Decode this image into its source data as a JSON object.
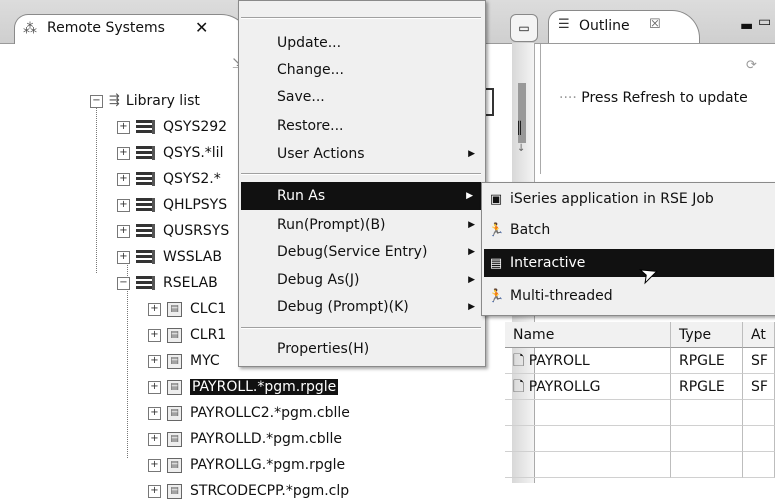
{
  "left_view": {
    "tab_title": "Remote Systems",
    "tab_close": "✕"
  },
  "tree": {
    "library_list": "Library list",
    "libraries": [
      "QSYS292",
      "QSYS.*lil",
      "QSYS2.*",
      "QHLPSYS",
      "QUSRSYS",
      "WSSLAB",
      "RSELAB"
    ],
    "objects": [
      "CLC1",
      "CLR1",
      "MYC",
      "PAYROLL.*pgm.rpgle",
      "PAYROLLC2.*pgm.cblle",
      "PAYROLLD.*pgm.cblle",
      "PAYROLLG.*pgm.rpgle",
      "STRCODECPP.*pgm.clp"
    ]
  },
  "context_menu": {
    "items": [
      "Update...",
      "Change...",
      "Save...",
      "Restore...",
      "User Actions",
      "Run As",
      "Run(Prompt)(B)",
      "Debug(Service Entry)",
      "Debug As(J)",
      "Debug (Prompt)(K)",
      "Properties(H)"
    ]
  },
  "submenu": {
    "items": [
      "iSeries application in RSE Job",
      "Batch",
      "Interactive",
      "Multi-threaded"
    ]
  },
  "outline": {
    "tab_title": "Outline",
    "tab_close": "☒",
    "message": "Press Refresh to update"
  },
  "table": {
    "headers": [
      "Name",
      "Type",
      "At"
    ],
    "rows": [
      [
        "PAYROLL",
        "RPGLE",
        "SF"
      ],
      [
        "PAYROLLG",
        "RPGLE",
        "SF"
      ]
    ]
  }
}
